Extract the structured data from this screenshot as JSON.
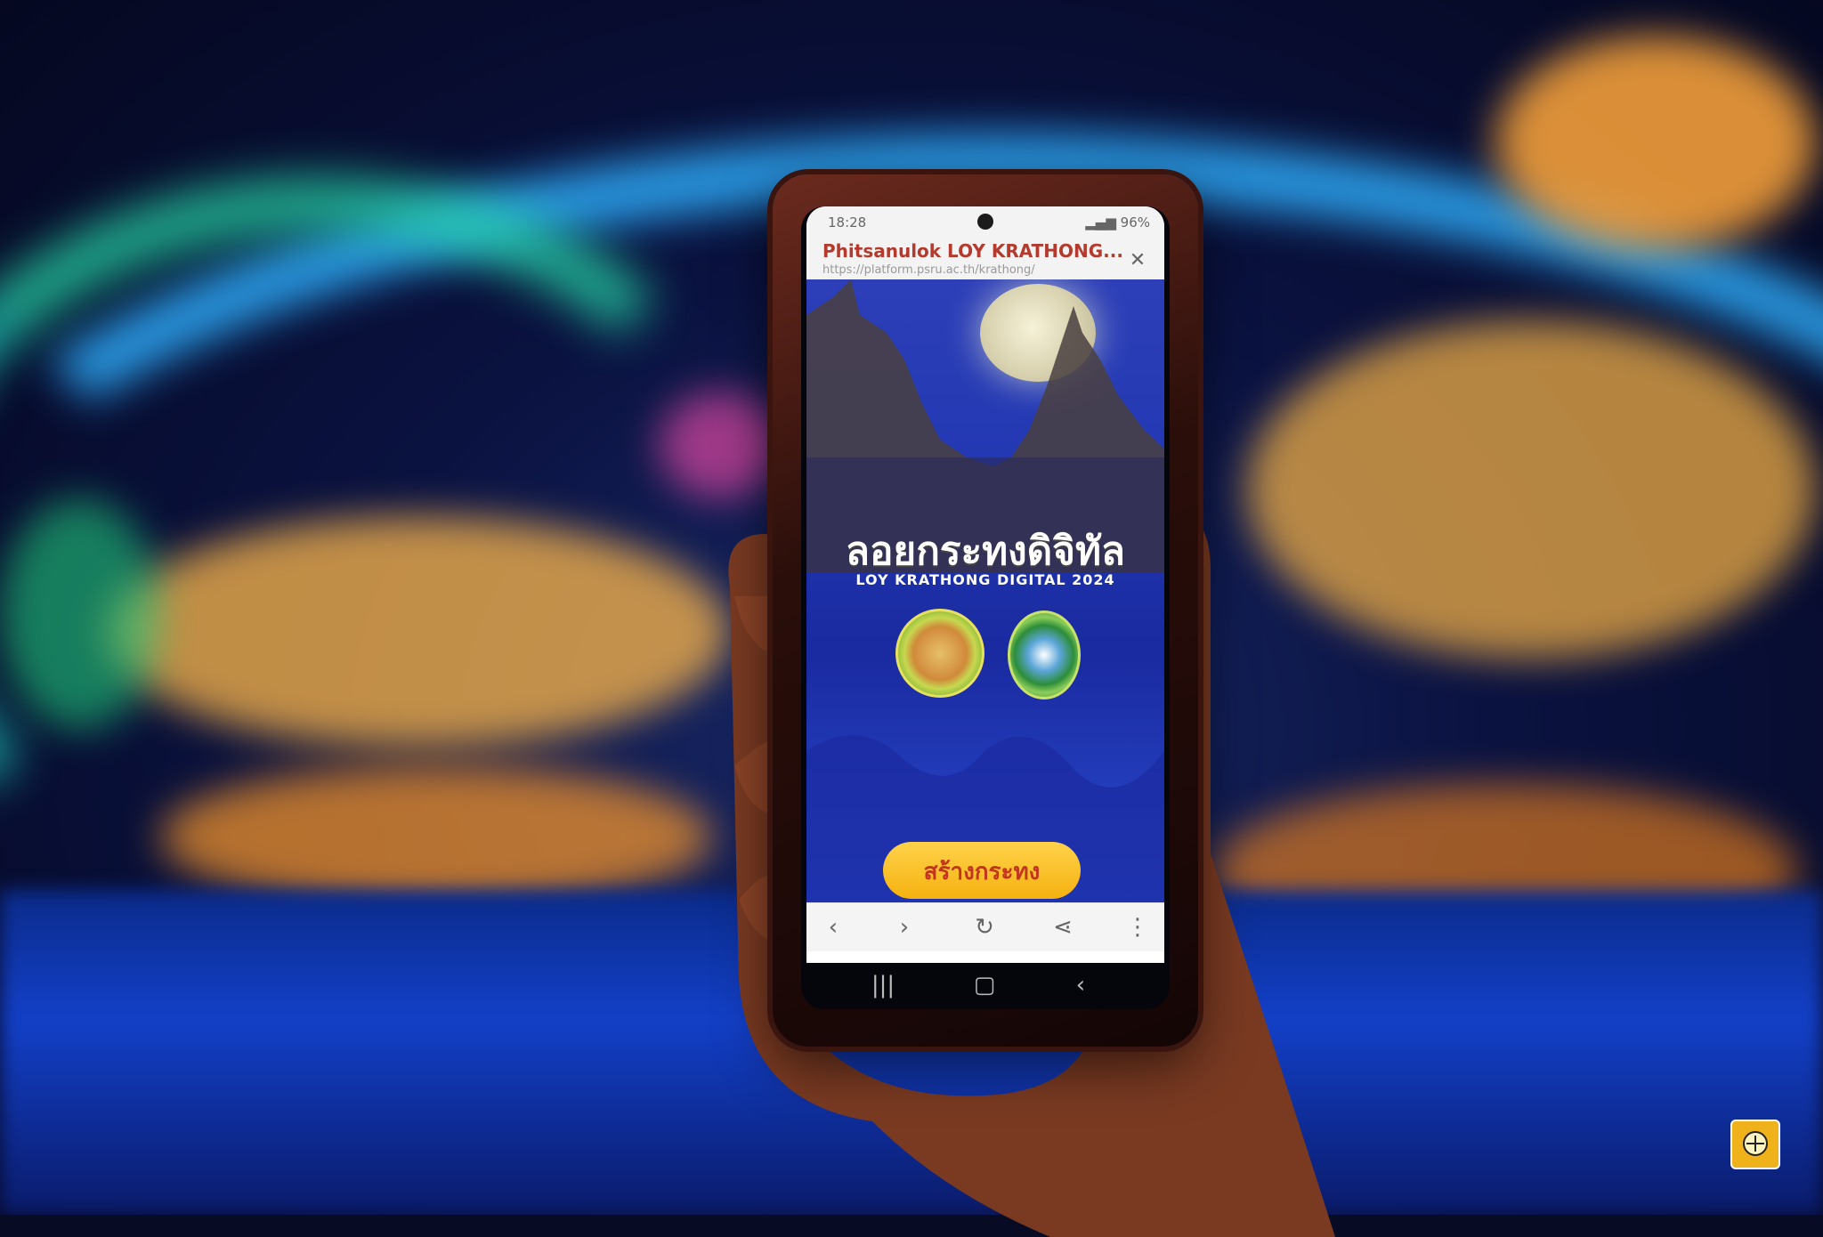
{
  "status_bar": {
    "time": "18:28",
    "battery": "96%"
  },
  "browser": {
    "page_title": "Phitsanulok LOY KRATHONG...",
    "url": "https://platform.psru.ac.th/krathong/"
  },
  "page": {
    "thai_title": "ลอยกระทงดิจิทัล",
    "subtitle": "LOY KRATHONG DIGITAL 2024",
    "create_button_label": "สร้างกระทง"
  },
  "icons": {
    "close": "close-icon",
    "back": "back-arrow-icon",
    "forward": "forward-arrow-icon",
    "reload": "reload-icon",
    "share": "share-icon",
    "more": "more-vertical-icon"
  },
  "colors": {
    "button_bg": "#f5b210",
    "button_text": "#c2351e",
    "page_bg": "#2238b2"
  }
}
